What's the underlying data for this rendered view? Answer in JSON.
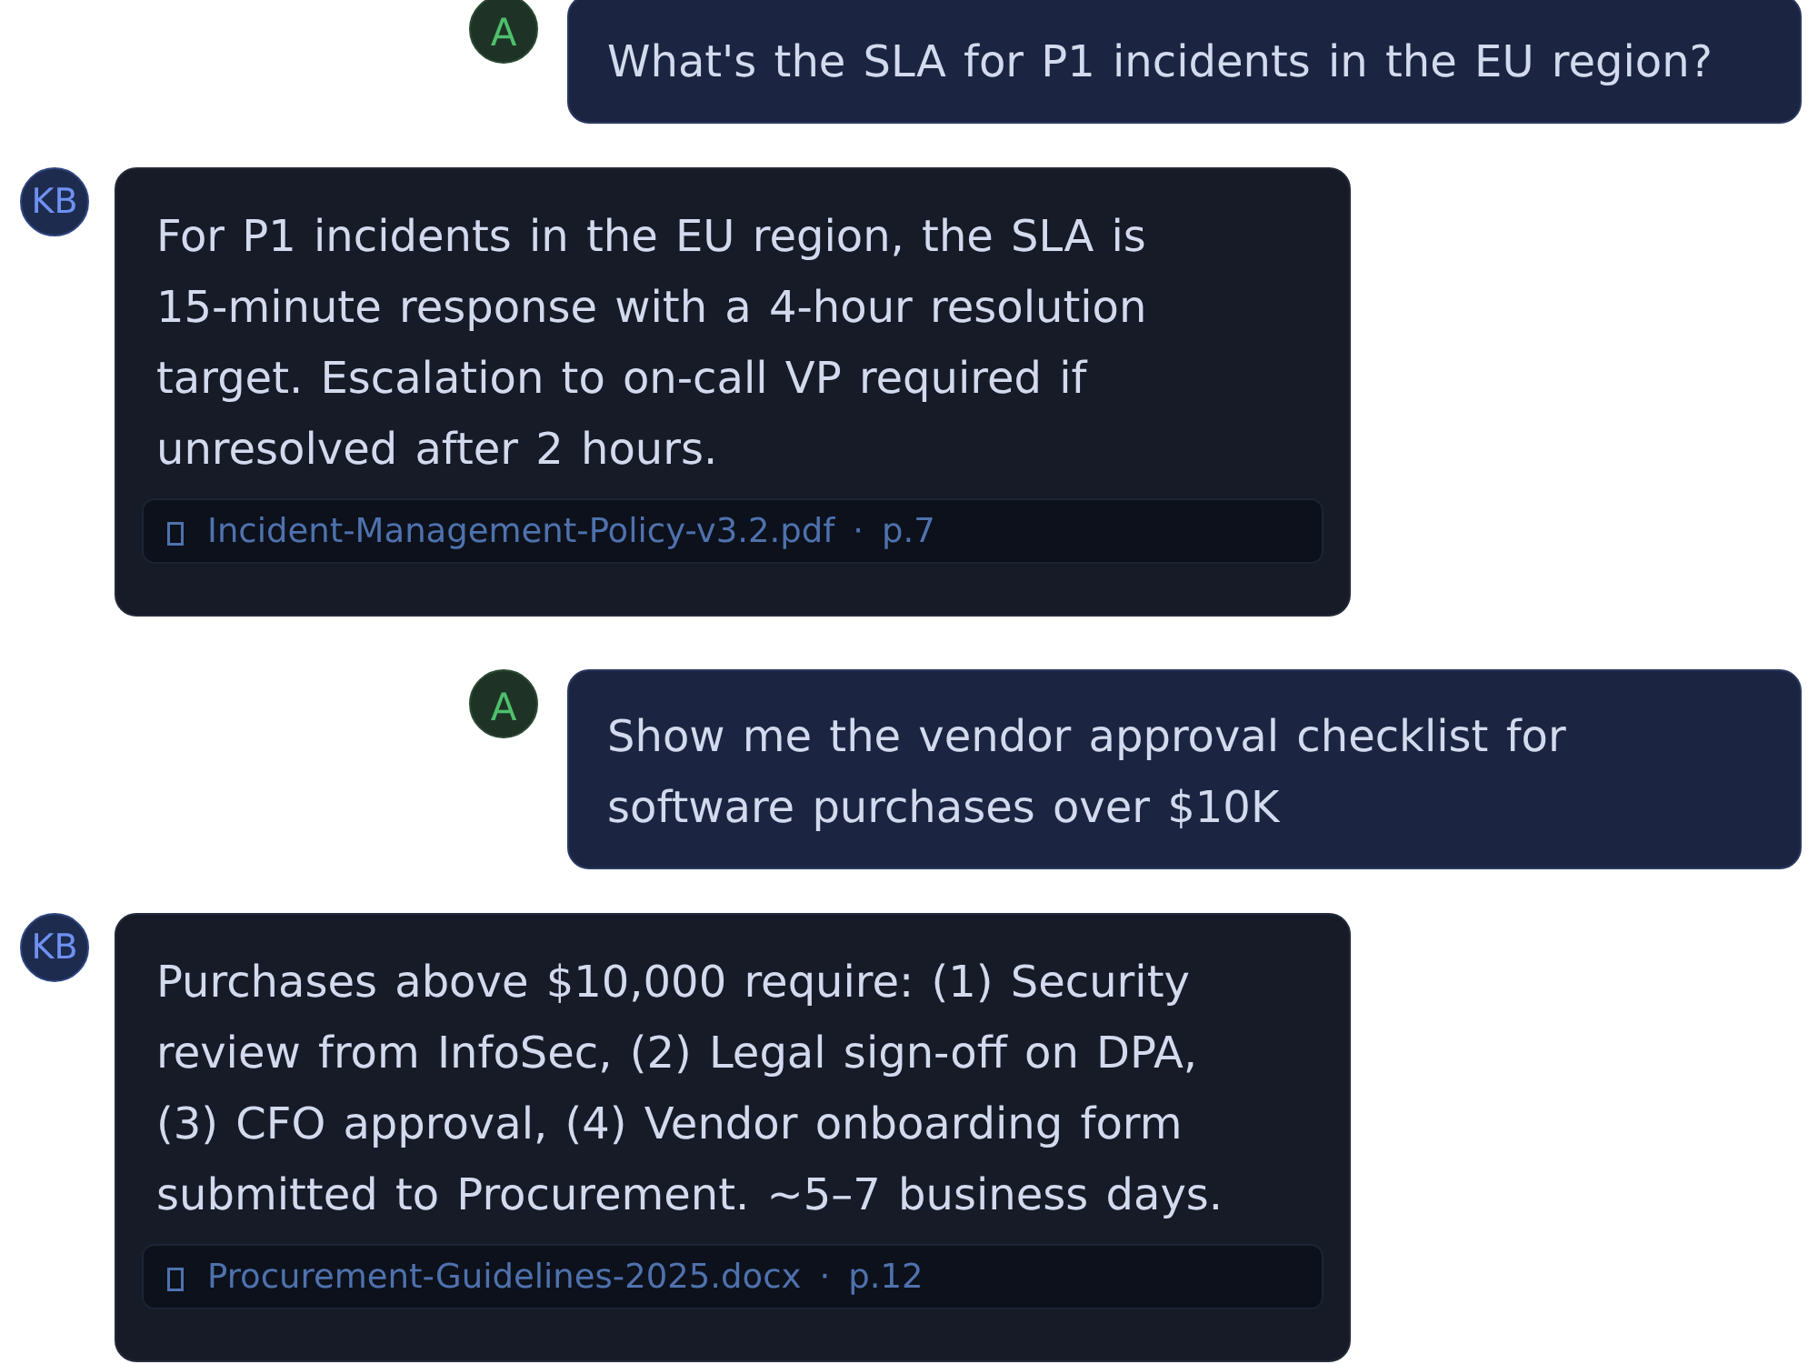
{
  "messages": [
    {
      "kind": "user",
      "avatar": "A",
      "text": "What's the SLA for P1 incidents in the EU region?"
    },
    {
      "kind": "assistant",
      "avatar": "KB",
      "text": "For P1 incidents in the EU region, the SLA is 15-minute response with a 4-hour resolution target. Escalation to on-call VP required if unresolved after 2 hours.",
      "citation": {
        "file": "Incident-Management-Policy-v3.2.pdf",
        "separator": "·",
        "page": "p.7"
      }
    },
    {
      "kind": "user",
      "avatar": "A",
      "text": "Show me the vendor approval checklist for software purchases over $10K"
    },
    {
      "kind": "assistant",
      "avatar": "KB",
      "text": "Purchases above $10,000 require: (1) Security review from InfoSec, (2) Legal sign-off on DPA, (3) CFO approval, (4) Vendor onboarding form submitted to Procurement. ~5–7 business days.",
      "citation": {
        "file": "Procurement-Guidelines-2025.docx",
        "separator": "·",
        "page": "p.12"
      }
    }
  ]
}
